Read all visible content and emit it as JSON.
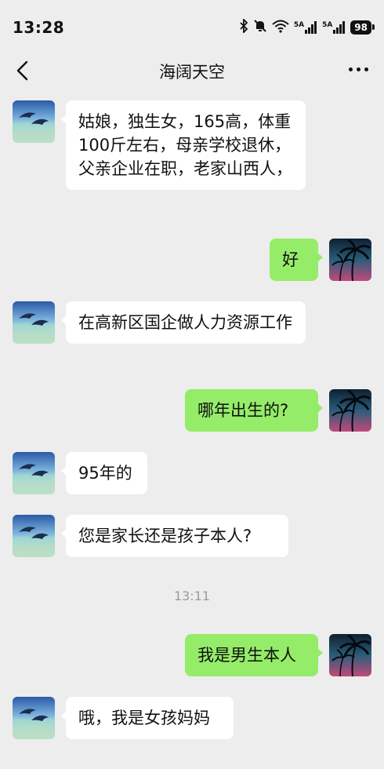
{
  "status": {
    "time": "13:28",
    "network_1": "5A",
    "network_2": "5A",
    "battery": "98"
  },
  "chat": {
    "title": "海阔天空"
  },
  "avatars": {
    "other": "dolphin-avatar",
    "self": "palm-tree-avatar"
  },
  "messages": [
    {
      "side": "left",
      "text": "姑娘，独生女，165高，体重100斤左右，母亲学校退休，父亲企业在职，老家山西人，"
    },
    {
      "side": "right",
      "text": "好"
    },
    {
      "side": "left",
      "text": "在高新区国企做人力资源工作"
    },
    {
      "side": "right",
      "text": "哪年出生的?"
    },
    {
      "side": "left",
      "text": "95年的"
    },
    {
      "side": "left",
      "text": "您是家长还是孩子本人?"
    },
    {
      "side": "right",
      "text": "我是男生本人"
    },
    {
      "side": "left",
      "text": "哦，我是女孩妈妈"
    }
  ],
  "timestamp": "13:11"
}
